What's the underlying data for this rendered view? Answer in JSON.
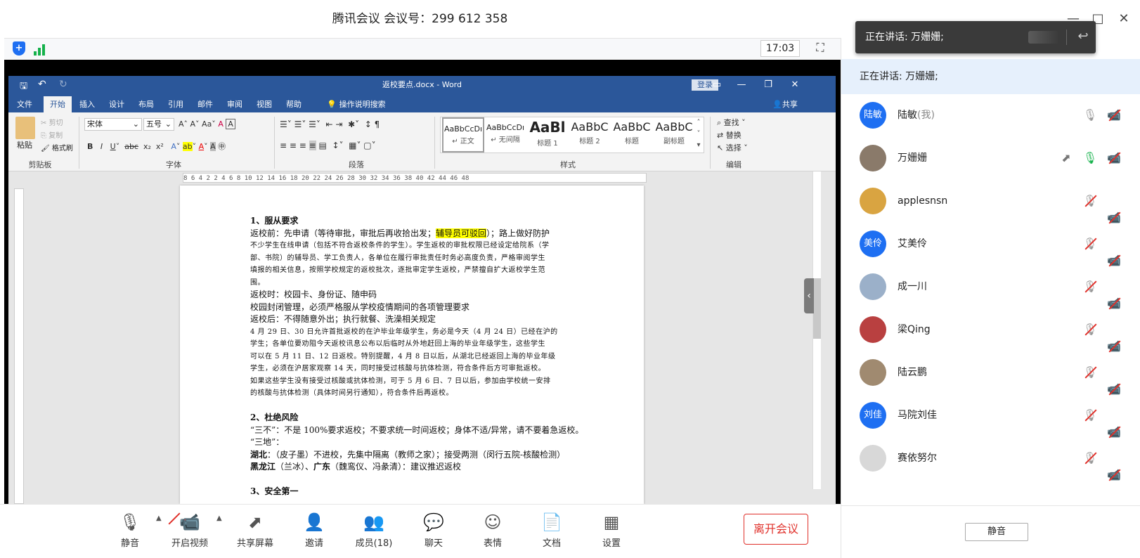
{
  "meeting": {
    "title": "腾讯会议 会议号：299 612 358",
    "time": "17:03"
  },
  "window_controls": {
    "minimize": "—",
    "maximize": "□",
    "close": "✕"
  },
  "word": {
    "doc_title": "返校要点.docx  -  Word",
    "login": "登录",
    "share": "共享",
    "tabs": [
      "文件",
      "开始",
      "插入",
      "设计",
      "布局",
      "引用",
      "邮件",
      "审阅",
      "视图",
      "帮助"
    ],
    "search": "操作说明搜索",
    "ribbon": {
      "paste": "粘贴",
      "cut": "剪切",
      "copy": "复制",
      "format_painter": "格式刷",
      "clipboard": "剪贴板",
      "font_name": "宋体",
      "font_size": "五号",
      "font": "字体",
      "paragraph": "段落",
      "styles": "样式",
      "editing": "编辑",
      "find": "查找",
      "replace": "替换",
      "select": "选择",
      "style_items": [
        {
          "sample": "AaBbCcDı",
          "name": "↵ 正文"
        },
        {
          "sample": "AaBbCcDı",
          "name": "↵ 无间隔"
        },
        {
          "sample": "AaBl",
          "name": "标题 1"
        },
        {
          "sample": "AaBbC",
          "name": "标题 2"
        },
        {
          "sample": "AaBbC",
          "name": "标题"
        },
        {
          "sample": "AaBbC",
          "name": "副标题"
        }
      ]
    },
    "ruler": "8   6   4   2       2   4   6   8  10  12  14  16  18  20  22  24  26  28  30  32  34  36  38  40  42  44  46  48",
    "doc": {
      "h1": "1、服从要求",
      "l1a": "返校前：先申请（等待审批，审批后再收拾出发；",
      "l1b": "辅导员可驳回",
      "l1c": "）；路上做好防护",
      "p1": [
        "不少学生在线申请（包括不符合返校条件的学生）。学生返校的审批权限已经设定给院系（学",
        "部、书院）的辅导员、学工负责人，各单位在履行审批责任时务必高度负责，严格审阅学生",
        "填报的相关信息，按照学校规定的返校批次，逐批审定学生返校，严禁擅自扩大返校学生范",
        "围。"
      ],
      "l2": "返校时：校园卡、身份证、随申码",
      "l3": "校园封闭管理，必须严格服从学校疫情期间的各项管理要求",
      "l4": "返校后：不得随意外出；执行就餐、洗澡相关规定",
      "p2": [
        "4 月 29 日、30 日允许首批返校的在沪毕业年级学生，务必是今天（4 月 24 日）已经在沪的",
        "学生；各单位要劝阻今天返校讯息公布以后临时从外地赶回上海的毕业年级学生，这些学生",
        "可以在 5 月 11 日、12 日返校。特别提醒，4 月 8 日以后，从湖北已经返回上海的毕业年级",
        "学生，必须在沪居家观察 14 天，同时接受过核酸与抗体检测，符合条件后方可审批返校。",
        "如果这些学生没有接受过核酸或抗体检测，可于 5 月 6 日、7 日以后，参加由学校统一安排",
        "的核酸与抗体检测（具体时间另行通知），符合条件后再返校。"
      ],
      "h2": "2、杜绝风险",
      "l5": "“三不”：不是 100%要求返校；不要求统一时间返校；身体不适/异常，请不要着急返校。",
      "l6": "“三地”：",
      "l7a": "湖北",
      "l7b": "：（皮子墨）不进校，先集中隔离（教师之家）；接受两测（闵行五院-核酸检测）",
      "l8a": "黑龙江",
      "l8b": "（兰冰）、",
      "l8c": "广东",
      "l8d": "（魏鸾仪、冯彖清）：建议推迟返校",
      "h3": "3、安全第一"
    }
  },
  "toolbar": {
    "mute": "静音",
    "video": "开启视频",
    "share": "共享屏幕",
    "invite": "邀请",
    "members": "成员(18)",
    "chat": "聊天",
    "emoji": "表情",
    "docs": "文档",
    "settings": "设置",
    "leave": "离开会议"
  },
  "sidebar": {
    "speaking": "正在讲话: 万姗姗;",
    "mute_all": "静音",
    "participants": [
      {
        "name": "陆敏",
        "me": "(我)",
        "avatar_text": "陆敏",
        "avatar_color": "#1e6ff2"
      },
      {
        "name": "万姗姗",
        "me": "",
        "avatar_text": "",
        "avatar_color": "#8a7a6a"
      },
      {
        "name": "applesnsn",
        "me": "",
        "avatar_text": "",
        "avatar_color": "#d9a441"
      },
      {
        "name": "艾美伶",
        "me": "",
        "avatar_text": "美伶",
        "avatar_color": "#1e6ff2"
      },
      {
        "name": "成一川",
        "me": "",
        "avatar_text": "",
        "avatar_color": "#9bb0c9"
      },
      {
        "name": "梁Qing",
        "me": "",
        "avatar_text": "",
        "avatar_color": "#b94040"
      },
      {
        "name": "陆云鹏",
        "me": "",
        "avatar_text": "",
        "avatar_color": "#a08a70"
      },
      {
        "name": "马院刘佳",
        "me": "",
        "avatar_text": "刘佳",
        "avatar_color": "#1e6ff2"
      },
      {
        "name": "赛依努尔",
        "me": "",
        "avatar_text": "",
        "avatar_color": "#d8d8d8"
      }
    ]
  },
  "toast": {
    "text": "正在讲话: 万姗姗;"
  },
  "colors": {
    "accent": "#1e6ff2",
    "word_blue": "#2b579a",
    "danger": "#e0302a",
    "speaking_bg": "#e6f0fc"
  }
}
